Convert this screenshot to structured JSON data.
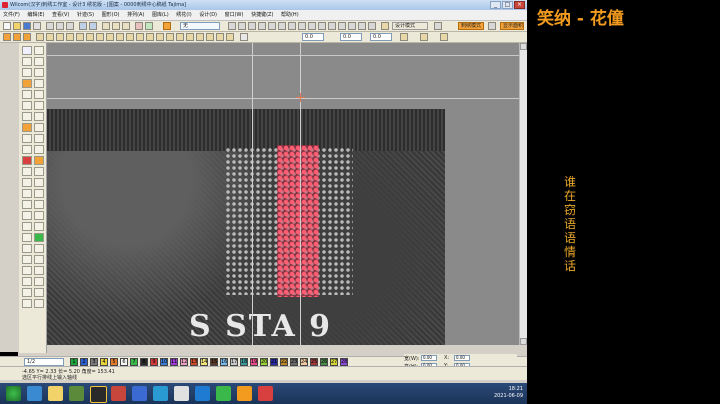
{
  "window": {
    "title": "Wilcom(汉字)刺绣工作室 - 设计3 绣花版 - [图案 - 0000刺绣中心稿纸 Tajima]"
  },
  "menu": {
    "items": [
      "文件(F)",
      "编辑(E)",
      "查看(V)",
      "针迹(S)",
      "图形(O)",
      "排列(A)",
      "图库(L)",
      "绣花(I)",
      "设计(D)",
      "窗口(W)",
      "快捷键(Z)",
      "帮助(H)"
    ],
    "mode_label": "设计模式",
    "mode_button": "刺绣模式",
    "show_button": "显示面积"
  },
  "toolbar": {
    "thread_select": "无",
    "field_a": "0.0",
    "field_b": "0.0",
    "field_c": "0.0"
  },
  "palette": {
    "colors": [
      "#1aa33a",
      "#2a5fd0",
      "#7a7a7a",
      "#e8d23a",
      "#e37a2a",
      "#f4f4f4",
      "#3ab84a",
      "#2a2a2a",
      "#d23a3a",
      "#3a7ad2",
      "#9a3ad2",
      "#e8a0c0",
      "#c84a2a",
      "#f2e27a",
      "#5a3a2a",
      "#7ab8e8",
      "#c8c8c8",
      "#3a9a9a",
      "#e84a8a",
      "#9ad23a",
      "#2a2aa0",
      "#b8862a",
      "#6a6a6a",
      "#f0c8a0",
      "#a03a3a",
      "#4a8a4a",
      "#d2d23a",
      "#8a4ad2"
    ],
    "numbers": [
      "1",
      "2",
      "3",
      "4",
      "5",
      "6",
      "7",
      "8",
      "9",
      "10",
      "11",
      "12",
      "13",
      "14",
      "15",
      "16",
      "17",
      "18",
      "19",
      "20",
      "21",
      "22",
      "23",
      "24",
      "25",
      "26",
      "27",
      "28"
    ],
    "count_label": "1/2"
  },
  "coords": {
    "w_label": "宽(W):",
    "h_label": "高(H):",
    "x_label": "X:",
    "y_label": "Y:",
    "w_value": "0.00",
    "h_value": "0.00",
    "x_value": "0.00",
    "y_value": "0.00"
  },
  "status": {
    "line1": "-4.65 Y= 2.33 长= 5.20 角度= 153.41",
    "line2": "选区平行排线上输入轴线"
  },
  "clock": {
    "time": "18:21",
    "date": "2021-06-09"
  },
  "overlay": {
    "brand": "笑纳 - 花僮",
    "vertical_text": "谁在窃语语情话",
    "embroidery_text": "S STA 9"
  }
}
